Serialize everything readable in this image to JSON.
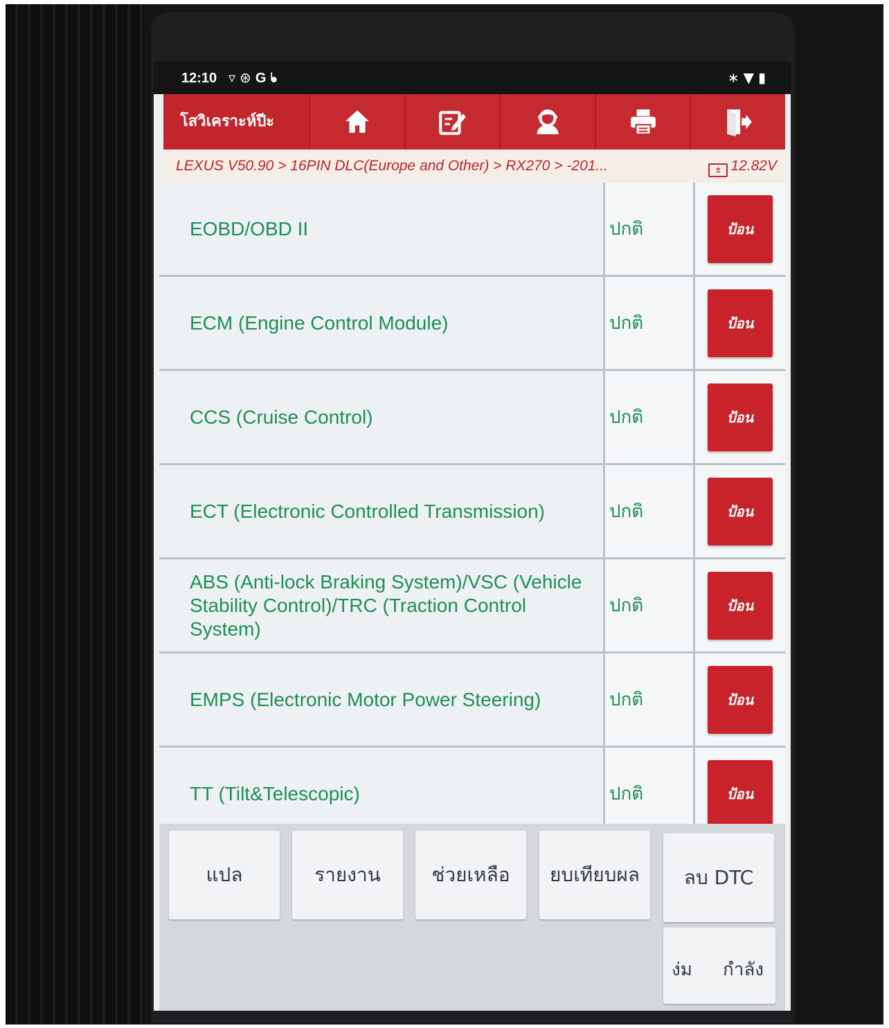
{
  "status_bar": {
    "time": "12:10",
    "left_icons": [
      "wifi-icon",
      "bluetooth-icon",
      "google-icon",
      "stethoscope-icon"
    ],
    "right_icons": [
      "bluetooth-icon",
      "wifi-icon",
      "battery-icon"
    ]
  },
  "toolbar": {
    "title": "โสวิเคราะห์ปีะ",
    "buttons": [
      "home-icon",
      "edit-icon",
      "support-icon",
      "print-icon",
      "exit-icon"
    ]
  },
  "breadcrumb": {
    "path": "LEXUS V50.90 > 16PIN DLC(Europe and Other) > RX270 > -201...",
    "voltage": "12.82V"
  },
  "modules": [
    {
      "name": "EOBD/OBD II",
      "status": "ปกติ",
      "action": "ป้อน"
    },
    {
      "name": "ECM (Engine Control Module)",
      "status": "ปกติ",
      "action": "ป้อน"
    },
    {
      "name": "CCS (Cruise Control)",
      "status": "ปกติ",
      "action": "ป้อน"
    },
    {
      "name": "ECT (Electronic Controlled Transmission)",
      "status": "ปกติ",
      "action": "ป้อน"
    },
    {
      "name": "ABS (Anti-lock Braking System)/VSC (Vehicle Stability Control)/TRC (Traction Control System)",
      "status": "ปกติ",
      "action": "ป้อน"
    },
    {
      "name": "EMPS (Electronic Motor Power Steering)",
      "status": "ปกติ",
      "action": "ป้อน"
    },
    {
      "name": "TT (Tilt&Telescopic)",
      "status": "ปกติ",
      "action": "ป้อน"
    }
  ],
  "bottom_bar": {
    "translate": "แปล",
    "report": "รายงาน",
    "help": "ช่วยเหลือ",
    "compare": "ยบเทียบผล",
    "clear_dtc": "ลบ DTC",
    "wide_left": "ง่ม",
    "wide_right": "กำลัง"
  },
  "colors": {
    "accent_red": "#c0262c",
    "module_green": "#1e8f55"
  }
}
